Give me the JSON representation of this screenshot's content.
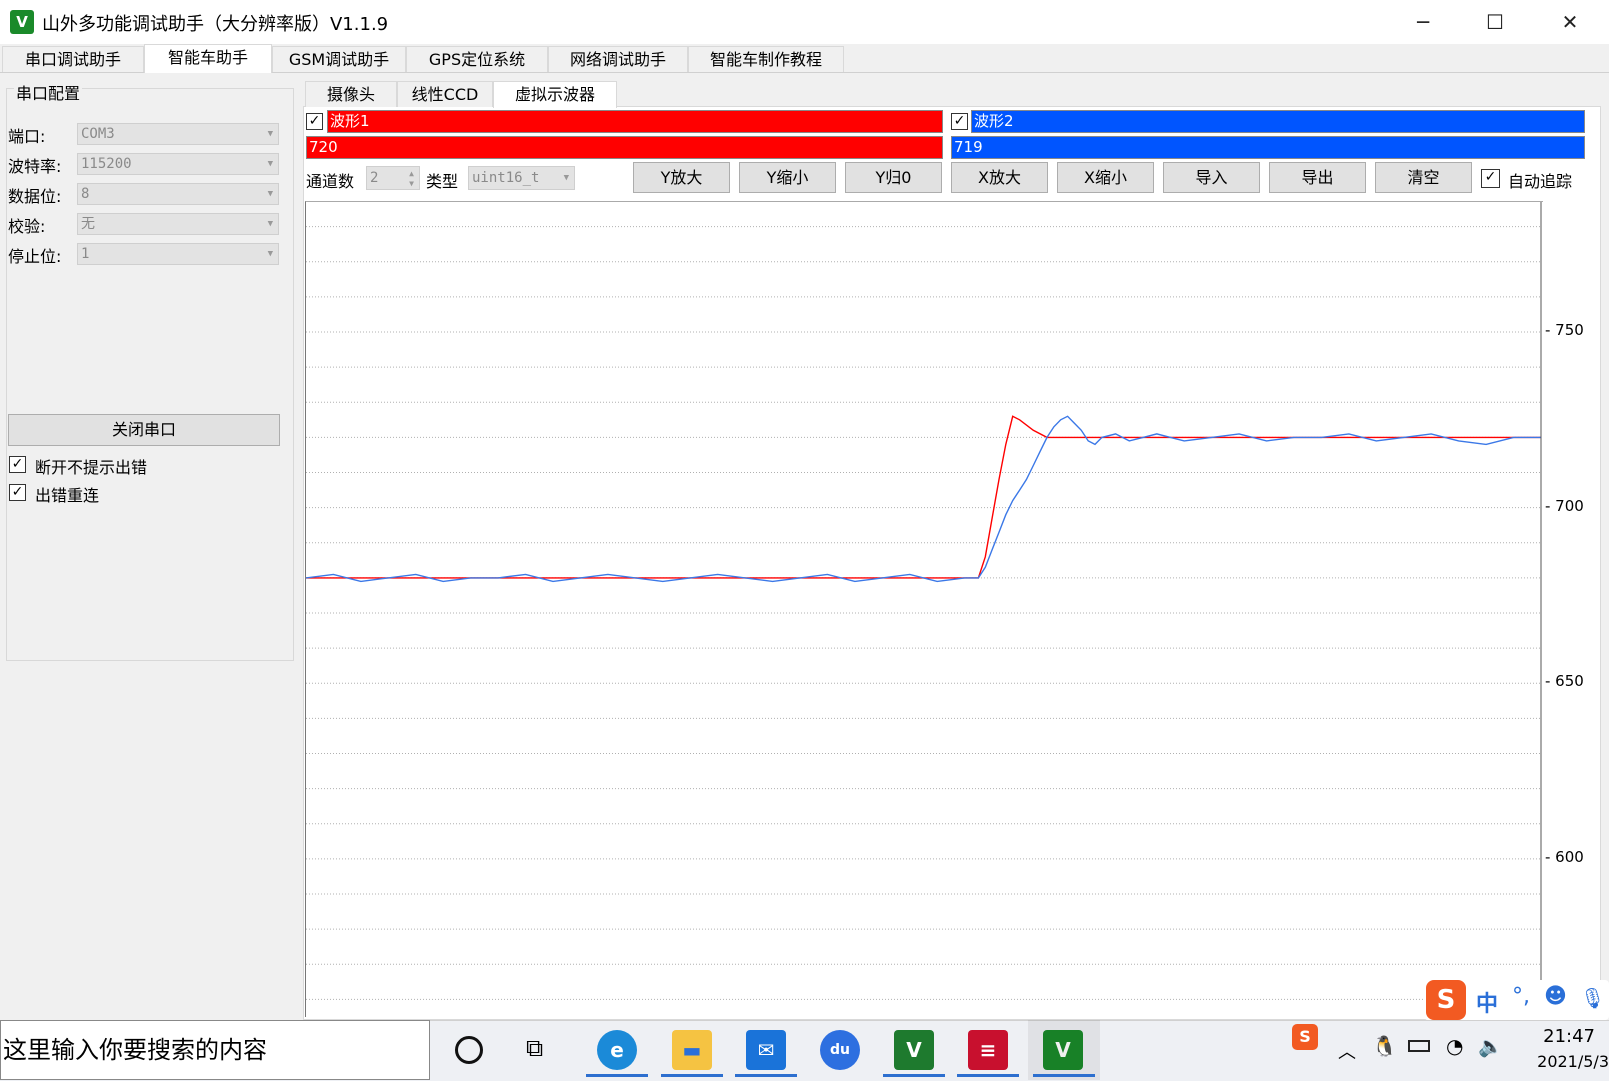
{
  "window": {
    "logo": "V",
    "title": "山外多功能调试助手（大分辨率版）V1.1.9",
    "minimize": "─",
    "maximize": "☐",
    "close": "✕"
  },
  "main_tabs": [
    "串口调试助手",
    "智能车助手",
    "GSM调试助手",
    "GPS定位系统",
    "网络调试助手",
    "智能车制作教程"
  ],
  "serial": {
    "group_title": "串口配置",
    "fields": [
      {
        "label": "端口:",
        "value": "COM3"
      },
      {
        "label": "波特率:",
        "value": "115200"
      },
      {
        "label": "数据位:",
        "value": "8"
      },
      {
        "label": "校验:",
        "value": "无"
      },
      {
        "label": "停止位:",
        "value": "1"
      }
    ],
    "close_button": "关闭串口",
    "checkboxes": [
      {
        "label": "断开不提示出错",
        "checked": true
      },
      {
        "label": "出错重连",
        "checked": true
      }
    ]
  },
  "sub_tabs": [
    "摄像头",
    "线性CCD",
    "虚拟示波器"
  ],
  "waves": [
    {
      "name": "波形1",
      "value": "720",
      "color": "#ff0000",
      "checked": true
    },
    {
      "name": "波形2",
      "value": "719",
      "color": "#0055ff",
      "checked": true
    }
  ],
  "controls": {
    "channels_label": "通道数",
    "channels_value": "2",
    "type_label": "类型",
    "type_value": "uint16_t",
    "buttons": [
      "Y放大",
      "Y缩小",
      "Y归0",
      "X放大",
      "X缩小",
      "导入",
      "导出",
      "清空"
    ],
    "autotrack_label": "自动追踪",
    "autotrack_checked": true
  },
  "chart_data": {
    "type": "line",
    "ylim": [
      555,
      787
    ],
    "yticks": [
      600,
      650,
      700,
      750
    ],
    "grid": true,
    "series": [
      {
        "name": "波形1",
        "color": "#ff0000",
        "x": [
          0,
          98,
          99,
          100,
          101,
          102,
          103,
          104,
          106,
          108,
          110,
          112,
          180
        ],
        "y": [
          680,
          680,
          686,
          697,
          708,
          718,
          726,
          725,
          722,
          720,
          720,
          720,
          720
        ]
      },
      {
        "name": "波形2",
        "color": "#3b78e7",
        "x": [
          0,
          4,
          8,
          12,
          16,
          20,
          24,
          28,
          32,
          36,
          40,
          44,
          48,
          52,
          56,
          60,
          64,
          68,
          72,
          76,
          80,
          84,
          88,
          92,
          96,
          98,
          99,
          100,
          101,
          102,
          103,
          104,
          105,
          106,
          107,
          108,
          109,
          110,
          111,
          112,
          113,
          114,
          115,
          116,
          118,
          120,
          122,
          124,
          126,
          128,
          132,
          136,
          140,
          144,
          148,
          152,
          156,
          160,
          164,
          168,
          172,
          176,
          180
        ],
        "y": [
          680,
          681,
          679,
          680,
          681,
          679,
          680,
          680,
          681,
          679,
          680,
          681,
          680,
          679,
          680,
          681,
          680,
          679,
          680,
          681,
          679,
          680,
          681,
          679,
          680,
          680,
          683,
          688,
          693,
          698,
          702,
          705,
          708,
          712,
          716,
          720,
          723,
          725,
          726,
          724,
          722,
          719,
          718,
          720,
          721,
          719,
          720,
          721,
          720,
          719,
          720,
          721,
          719,
          720,
          720,
          721,
          719,
          720,
          721,
          719,
          718,
          720,
          720
        ]
      }
    ]
  },
  "taskbar": {
    "search_placeholder": "这里输入你要搜索的内容",
    "ime_label": "中",
    "time": "21:47",
    "date": "2021/5/3"
  }
}
